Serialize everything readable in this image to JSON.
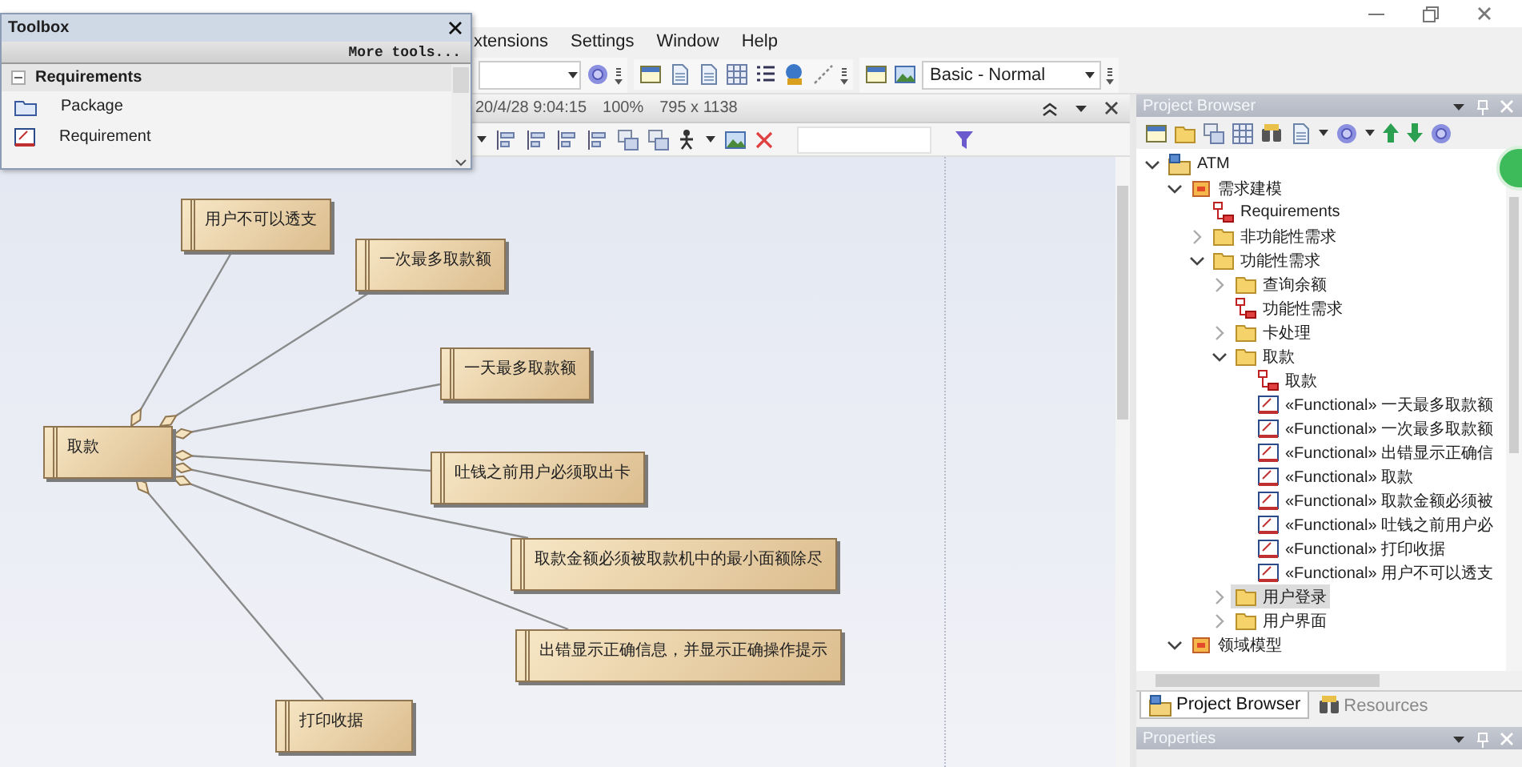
{
  "menu": [
    {
      "label": "xtensions"
    },
    {
      "label": "Settings"
    },
    {
      "label": "Window"
    },
    {
      "label": "Help"
    }
  ],
  "toolbar": {
    "perspective": "Basic - Normal"
  },
  "toolbox": {
    "title": "Toolbox",
    "more": "More tools...",
    "group": {
      "label": "Requirements",
      "expanded": true
    },
    "items": [
      {
        "label": "Package",
        "kind": "package"
      },
      {
        "label": "Requirement",
        "kind": "requirement"
      }
    ]
  },
  "diagram": {
    "info": [
      "20/4/28 9:04:15",
      "100%",
      "795 x 1138"
    ],
    "hub": {
      "text": "取款"
    },
    "linked_nodes": [
      {
        "text": "用户不可以透支"
      },
      {
        "text": "一次最多取款额"
      },
      {
        "text": "一天最多取款额"
      },
      {
        "text": "吐钱之前用户必须取出卡"
      },
      {
        "text": "取款金额必须被取款机中的最小面额除尽"
      },
      {
        "text": "出错显示正确信息，并显示正确操作提示"
      },
      {
        "text": "打印收据"
      }
    ]
  },
  "browser": {
    "title": "Project Browser",
    "tree": [
      {
        "label": "ATM",
        "kind": "model",
        "expanded": true,
        "selected": false,
        "children": [
          {
            "label": "需求建模",
            "kind": "view",
            "expanded": true,
            "selected": false,
            "children": [
              {
                "label": "Requirements",
                "kind": "diagram",
                "selected": false
              },
              {
                "label": "非功能性需求",
                "kind": "folder",
                "expanded": false,
                "selected": false
              },
              {
                "label": "功能性需求",
                "kind": "folder",
                "expanded": true,
                "selected": false,
                "children": [
                  {
                    "label": "查询余额",
                    "kind": "folder",
                    "expanded": false,
                    "selected": false
                  },
                  {
                    "label": "功能性需求",
                    "kind": "diagram",
                    "selected": false
                  },
                  {
                    "label": "卡处理",
                    "kind": "folder",
                    "expanded": false,
                    "selected": false
                  },
                  {
                    "label": "取款",
                    "kind": "folder",
                    "expanded": true,
                    "selected": false,
                    "children": [
                      {
                        "label": "取款",
                        "kind": "diagram",
                        "selected": false
                      },
                      {
                        "label": "«Functional» 一天最多取款额",
                        "kind": "requirement",
                        "selected": false
                      },
                      {
                        "label": "«Functional» 一次最多取款额",
                        "kind": "requirement",
                        "selected": false
                      },
                      {
                        "label": "«Functional» 出错显示正确信",
                        "kind": "requirement",
                        "selected": false
                      },
                      {
                        "label": "«Functional» 取款",
                        "kind": "requirement",
                        "selected": false
                      },
                      {
                        "label": "«Functional» 取款金额必须被",
                        "kind": "requirement",
                        "selected": false
                      },
                      {
                        "label": "«Functional» 吐钱之前用户必",
                        "kind": "requirement",
                        "selected": false
                      },
                      {
                        "label": "«Functional» 打印收据",
                        "kind": "requirement",
                        "selected": false
                      },
                      {
                        "label": "«Functional» 用户不可以透支",
                        "kind": "requirement",
                        "selected": false
                      }
                    ]
                  },
                  {
                    "label": "用户登录",
                    "kind": "folder",
                    "expanded": false,
                    "selected": true
                  },
                  {
                    "label": "用户界面",
                    "kind": "folder",
                    "expanded": false,
                    "selected": false
                  }
                ]
              }
            ]
          },
          {
            "label": "领域模型",
            "kind": "view",
            "expanded": true,
            "selected": false
          }
        ]
      }
    ],
    "tabs": [
      {
        "label": "Project Browser",
        "selected": true
      },
      {
        "label": "Resources",
        "selected": false
      }
    ]
  },
  "properties": {
    "title": "Properties"
  }
}
